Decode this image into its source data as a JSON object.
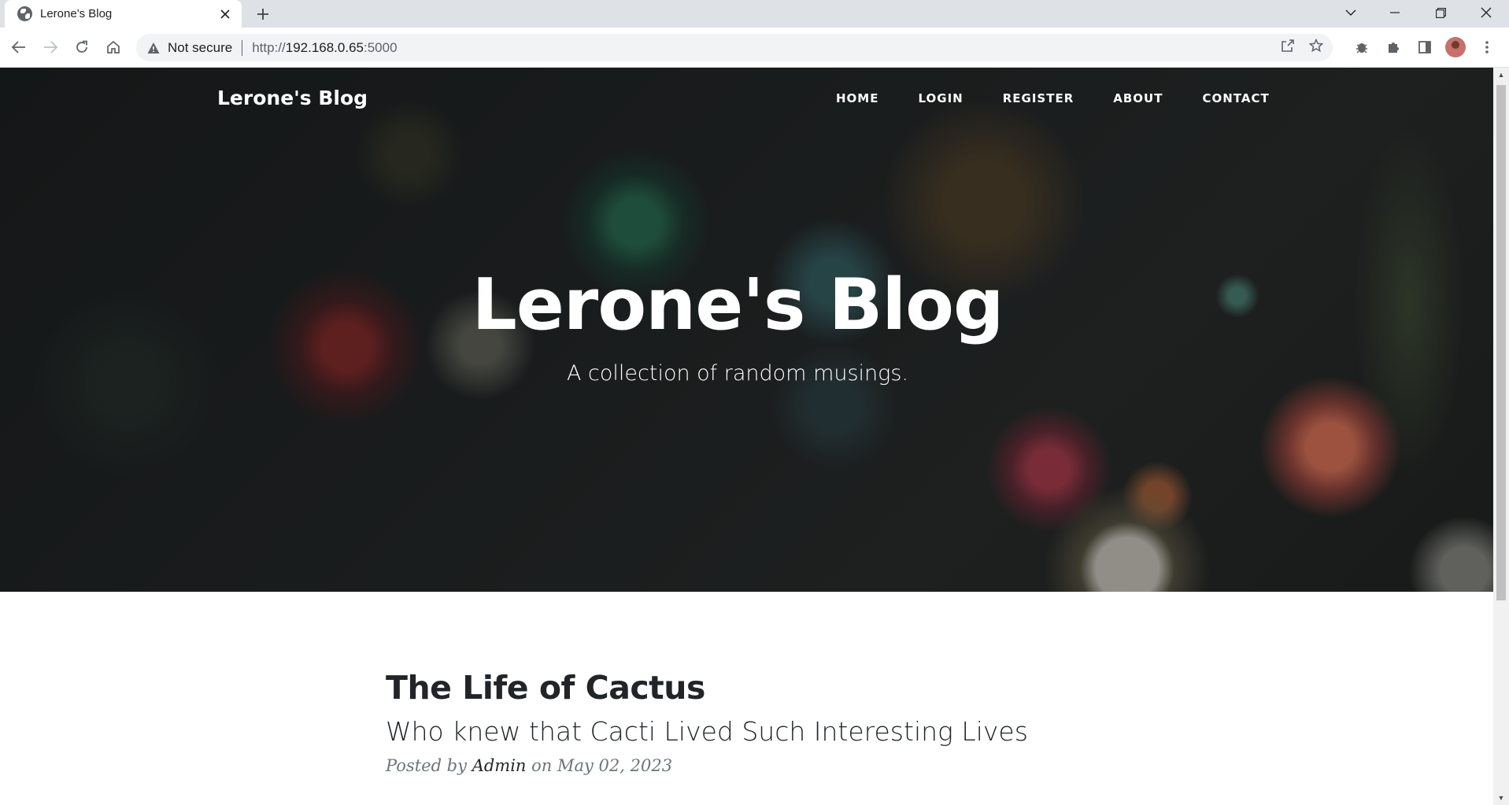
{
  "browser": {
    "tab_title": "Lerone's Blog",
    "security_label": "Not secure",
    "url_scheme": "http://",
    "url_host": "192.168.0.65",
    "url_port": ":5000"
  },
  "site": {
    "brand": "Lerone's Blog",
    "nav": [
      {
        "label": "HOME"
      },
      {
        "label": "LOGIN"
      },
      {
        "label": "REGISTER"
      },
      {
        "label": "ABOUT"
      },
      {
        "label": "CONTACT"
      }
    ],
    "heading": "Lerone's Blog",
    "subheading": "A collection of random musings."
  },
  "posts": [
    {
      "title": "The Life of Cactus",
      "subtitle": "Who knew that Cacti Lived Such Interesting Lives",
      "meta_prefix": "Posted by",
      "author": "Admin",
      "meta_on": "on",
      "date": "May 02, 2023"
    }
  ],
  "colors": {
    "heading_text": "#ffffff",
    "post_title": "#212529",
    "meta_text": "#6c757d",
    "tabbar": "#dee1e6"
  }
}
